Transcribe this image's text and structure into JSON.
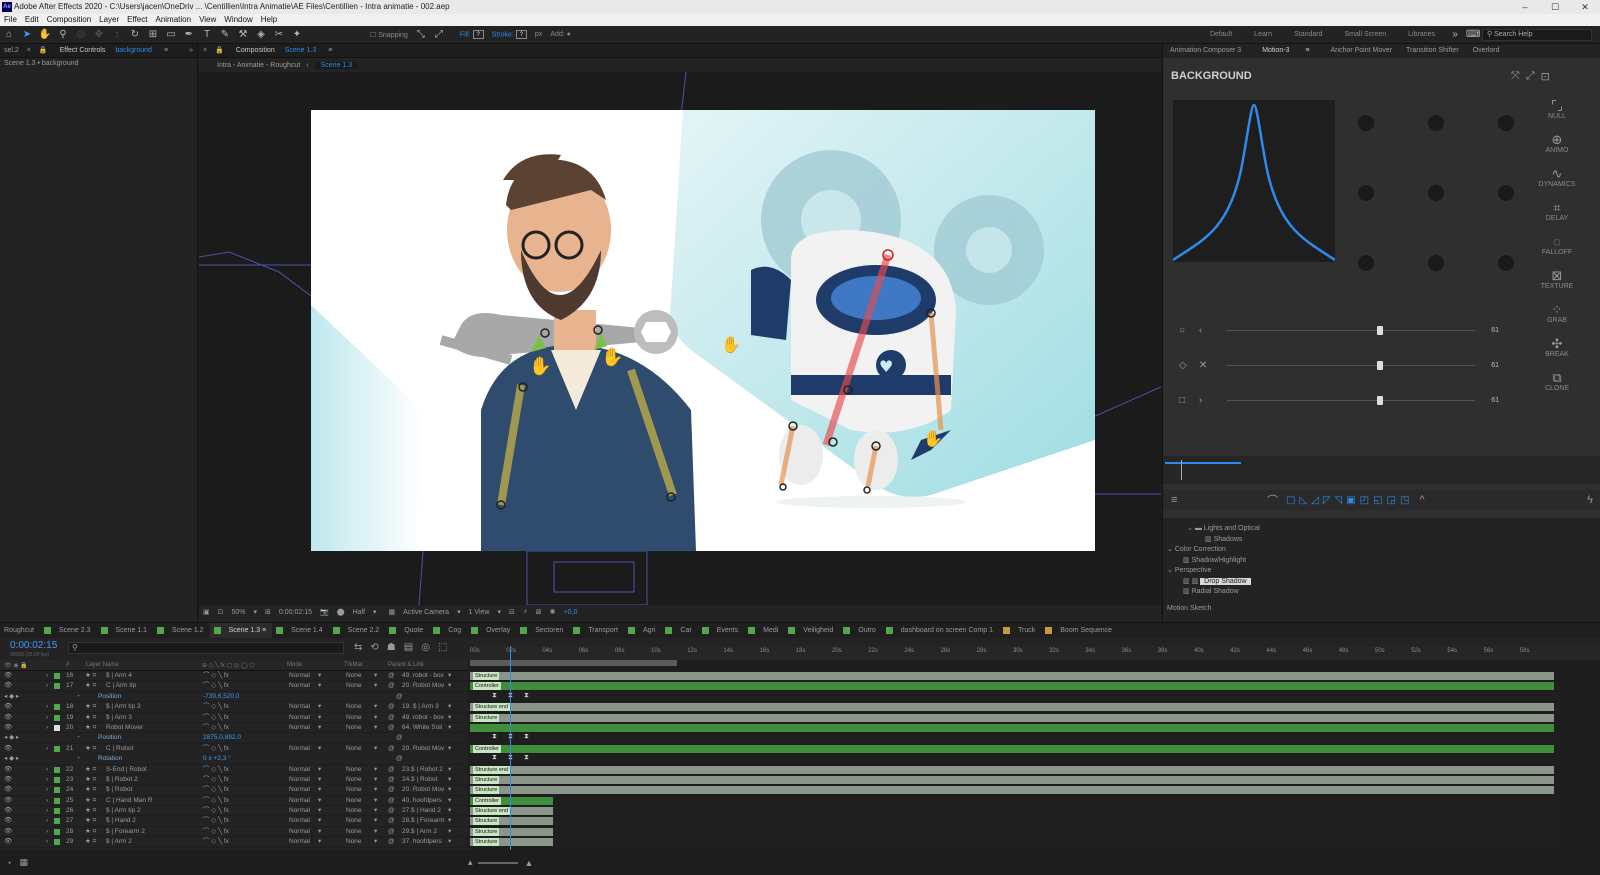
{
  "window": {
    "title": "Adobe After Effects 2020 - C:\\Users\\jacen\\OneDriv ... \\Centillien\\Intra Animatie\\AE Files\\Centillien - Intra animatie - 002.aep",
    "app_icon": "Ae"
  },
  "menu": [
    "File",
    "Edit",
    "Composition",
    "Layer",
    "Effect",
    "Animation",
    "View",
    "Window",
    "Help"
  ],
  "toolbar": {
    "snapping": "Snapping",
    "fill": "Fill:",
    "stroke": "Stroke:",
    "px": "px",
    "add": "Add:",
    "workspaces": [
      "Default",
      "Learn",
      "Standard",
      "Small Screen",
      "Libraries"
    ],
    "search_placeholder": "Search Help"
  },
  "left_panel": {
    "tab_id": "sel.2",
    "tab_label": "Effect Controls",
    "tab_layer": "background",
    "breadcrumb": "Scene 1.3 • background"
  },
  "comp_panel": {
    "tab_label": "Composition",
    "tab_comp": "Scene 1.3",
    "flow": [
      "Intra - Animatie - Roughcut",
      "Scene 1.3"
    ],
    "viewer_bar": {
      "zoom": "50%",
      "time": "0:00:02:15",
      "resolution": "Half",
      "camera": "Active Camera",
      "views": "1 View",
      "exposure": "+0,0"
    }
  },
  "right_panel": {
    "tabs": [
      "Animation Composer 3",
      "Motion-3",
      "Anchor Point Mover",
      "Transition Shifter",
      "Overlord"
    ],
    "active_tab": "Motion-3",
    "title": "BACKGROUND",
    "side_tools": [
      "NULL",
      "ANIMO",
      "DYNAMICS",
      "DELAY",
      "FALLOFF",
      "TEXTURE",
      "GRAB",
      "BREAK",
      "CLONE"
    ],
    "sliders": [
      {
        "value": "61",
        "level": 0.6
      },
      {
        "value": "61",
        "level": 0.6
      },
      {
        "value": "61",
        "level": 0.6
      }
    ],
    "effects_tree": [
      {
        "label": "Lights and Optical",
        "depth": 2,
        "kind": "folder"
      },
      {
        "label": "Shadows",
        "depth": 3,
        "kind": "item"
      },
      {
        "label": "Color Correction",
        "depth": 0,
        "kind": "folder"
      },
      {
        "label": "Shadow/Highlight",
        "depth": 1,
        "kind": "item"
      },
      {
        "label": "Perspective",
        "depth": 0,
        "kind": "folder"
      },
      {
        "label": "Drop Shadow",
        "depth": 1,
        "kind": "item",
        "selected": true
      },
      {
        "label": "Radial Shadow",
        "depth": 1,
        "kind": "item"
      },
      {
        "label": "Motion Sketch",
        "depth": 0,
        "kind": "folder"
      }
    ]
  },
  "timeline": {
    "comp_tabs": [
      {
        "label": "Roughcut",
        "color": ""
      },
      {
        "label": "Scene 2.3",
        "color": "#52a64c"
      },
      {
        "label": "Scene 1.1",
        "color": "#52a64c"
      },
      {
        "label": "Scene 1.2",
        "color": "#52a64c"
      },
      {
        "label": "Scene 1.3",
        "color": "#52a64c",
        "active": true
      },
      {
        "label": "Scene 1.4",
        "color": "#52a64c"
      },
      {
        "label": "Scene 2.2",
        "color": "#52a64c"
      },
      {
        "label": "Quote",
        "color": "#52a64c"
      },
      {
        "label": "Cog",
        "color": "#52a64c"
      },
      {
        "label": "Overlay",
        "color": "#52a64c"
      },
      {
        "label": "Sectoren",
        "color": "#52a64c"
      },
      {
        "label": "Transport",
        "color": "#52a64c"
      },
      {
        "label": "Agri",
        "color": "#52a64c"
      },
      {
        "label": "Car",
        "color": "#52a64c"
      },
      {
        "label": "Events",
        "color": "#52a64c"
      },
      {
        "label": "Medi",
        "color": "#52a64c"
      },
      {
        "label": "Veiligheid",
        "color": "#52a64c"
      },
      {
        "label": "Outro",
        "color": "#52a64c"
      },
      {
        "label": "dashboard on screen Comp 1",
        "color": "#52a64c"
      },
      {
        "label": "Truck",
        "color": "#c69a3a"
      },
      {
        "label": "Boom Sequence",
        "color": "#c69a3a"
      }
    ],
    "timecode": "0:00:02:15",
    "timecode_sub": "00065 (25.00 fps)",
    "columns": {
      "num": "#",
      "layer_name": "Layer Name",
      "mode": "Mode",
      "trkmat": "TrkMat",
      "parent": "Parent & Link"
    },
    "ruler": [
      "00s",
      "02s",
      "04s",
      "06s",
      "08s",
      "10s",
      "12s",
      "14s",
      "16s",
      "18s",
      "20s",
      "22s",
      "24s",
      "26s",
      "28s",
      "30s",
      "32s",
      "34s",
      "36s",
      "38s",
      "40s",
      "42s",
      "44s",
      "46s",
      "48s",
      "50s",
      "52s",
      "54s",
      "56s",
      "58s"
    ],
    "layers": [
      {
        "num": "16",
        "name": "$ | Arm 4",
        "mode": "Normal",
        "trkmat": "None",
        "parent": "49. robot - box",
        "color": "#52a64c",
        "bar_label": "Structure",
        "bar_color": "#8a968a",
        "bar_start": 0,
        "bar_end": 1
      },
      {
        "num": "17",
        "name": "C | Arm tip",
        "mode": "Normal",
        "trkmat": "None",
        "parent": "20. Robot Mov",
        "color": "#52a64c",
        "bar_label": "Controller",
        "bar_color": "#3f8d3d",
        "bar_start": 0,
        "bar_end": 1
      },
      {
        "num": "",
        "name": "Position",
        "value": "-739,6,520,0",
        "sub": true
      },
      {
        "num": "18",
        "name": "$ | Arm tip 3",
        "mode": "Normal",
        "trkmat": "None",
        "parent": "19. $ | Arm 3",
        "color": "#52a64c",
        "bar_label": "Structure end",
        "bar_color": "#8a968a",
        "bar_start": 0,
        "bar_end": 1
      },
      {
        "num": "19",
        "name": "$ | Arm 3",
        "mode": "Normal",
        "trkmat": "None",
        "parent": "49. robot - box",
        "color": "#52a64c",
        "bar_label": "Structure",
        "bar_color": "#8a968a",
        "bar_start": 0,
        "bar_end": 1
      },
      {
        "num": "20",
        "name": "Robot Mover",
        "mode": "Normal",
        "trkmat": "None",
        "parent": "64. White Soli",
        "color": "#e0e0e0",
        "bar_label": "",
        "bar_color": "#3f8d3d",
        "bar_start": 0,
        "bar_end": 1
      },
      {
        "num": "",
        "name": "Position",
        "value": "2875,0,892,0",
        "sub": true
      },
      {
        "num": "21",
        "name": "C | Robot",
        "mode": "Normal",
        "trkmat": "None",
        "parent": "20. Robot Mov",
        "color": "#52a64c",
        "bar_label": "Controller",
        "bar_color": "#3f8d3d",
        "bar_start": 0,
        "bar_end": 1
      },
      {
        "num": "",
        "name": "Rotation",
        "value": "0 x +2,3 °",
        "sub": true
      },
      {
        "num": "22",
        "name": "S-End | Robot",
        "mode": "Normal",
        "trkmat": "None",
        "parent": "23.$ | Robot 2",
        "color": "#52a64c",
        "bar_label": "Structure end",
        "bar_color": "#8a968a",
        "bar_start": 0,
        "bar_end": 1
      },
      {
        "num": "23",
        "name": "$ | Robot 2",
        "mode": "Normal",
        "trkmat": "None",
        "parent": "24.$ | Robot",
        "color": "#52a64c",
        "bar_label": "Structure",
        "bar_color": "#8a968a",
        "bar_start": 0,
        "bar_end": 1
      },
      {
        "num": "24",
        "name": "$ | Robot",
        "mode": "Normal",
        "trkmat": "None",
        "parent": "20. Robot Mov",
        "color": "#52a64c",
        "bar_label": "Structure",
        "bar_color": "#8a968a",
        "bar_start": 0,
        "bar_end": 1
      },
      {
        "num": "25",
        "name": "C | Hand Man R",
        "mode": "Normal",
        "trkmat": "None",
        "parent": "40. hoofdpers",
        "color": "#52a64c",
        "bar_label": "Controller",
        "bar_color": "#3f8d3d",
        "bar_start": 0,
        "bar_end": 0.08
      },
      {
        "num": "26",
        "name": "$ | Arm tip 2",
        "mode": "Normal",
        "trkmat": "None",
        "parent": "27.$ | Hand 2",
        "color": "#52a64c",
        "bar_label": "Structure end",
        "bar_color": "#8a968a",
        "bar_start": 0,
        "bar_end": 0.08
      },
      {
        "num": "27",
        "name": "$ | Hand 2",
        "mode": "Normal",
        "trkmat": "None",
        "parent": "28.$ | Forearm",
        "color": "#52a64c",
        "bar_label": "Structure",
        "bar_color": "#8a968a",
        "bar_start": 0,
        "bar_end": 0.08
      },
      {
        "num": "28",
        "name": "$ | Forearm 2",
        "mode": "Normal",
        "trkmat": "None",
        "parent": "29.$ | Arm 2",
        "color": "#52a64c",
        "bar_label": "Structure",
        "bar_color": "#8a968a",
        "bar_start": 0,
        "bar_end": 0.08
      },
      {
        "num": "29",
        "name": "$ | Arm 2",
        "mode": "Normal",
        "trkmat": "None",
        "parent": "37. hoofdpers",
        "color": "#52a64c",
        "bar_label": "Structure",
        "bar_color": "#8a968a",
        "bar_start": 0,
        "bar_end": 0.08
      }
    ]
  }
}
